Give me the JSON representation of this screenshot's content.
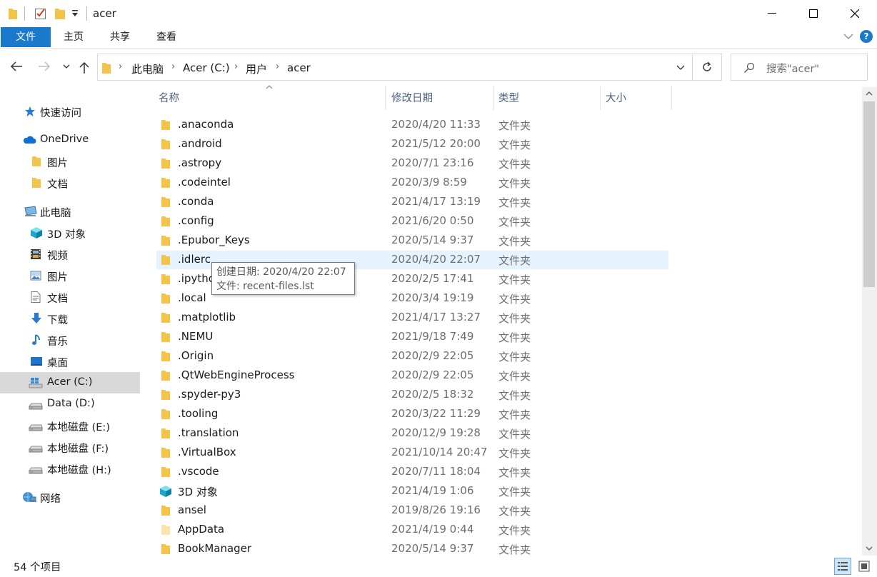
{
  "window": {
    "title": "acer",
    "colors": {
      "accent": "#1979ca",
      "folder": "#f3c34a",
      "hover": "#e5f3ff",
      "selected": "#d9d9d9"
    }
  },
  "ribbon": {
    "tabs": [
      "文件",
      "主页",
      "共享",
      "查看"
    ]
  },
  "address": {
    "crumbs": [
      "此电脑",
      "Acer (C:)",
      "用户",
      "acer"
    ],
    "search_placeholder": "搜索\"acer\""
  },
  "nav": {
    "items": [
      {
        "label": "快速访问",
        "icon": "star-icon"
      },
      {
        "label": "OneDrive",
        "icon": "cloud-icon"
      },
      {
        "label": "图片",
        "icon": "folder-icon"
      },
      {
        "label": "文档",
        "icon": "folder-icon"
      },
      {
        "label": "此电脑",
        "icon": "computer-icon"
      },
      {
        "label": "3D 对象",
        "icon": "cube-icon"
      },
      {
        "label": "视频",
        "icon": "film-icon"
      },
      {
        "label": "图片",
        "icon": "picture-icon"
      },
      {
        "label": "文档",
        "icon": "document-icon"
      },
      {
        "label": "下载",
        "icon": "download-arrow-icon"
      },
      {
        "label": "音乐",
        "icon": "music-note-icon"
      },
      {
        "label": "桌面",
        "icon": "desktop-icon"
      },
      {
        "label": "Acer (C:)",
        "icon": "windows-drive-icon"
      },
      {
        "label": "Data (D:)",
        "icon": "drive-icon"
      },
      {
        "label": "本地磁盘 (E:)",
        "icon": "drive-icon"
      },
      {
        "label": "本地磁盘 (F:)",
        "icon": "drive-icon"
      },
      {
        "label": "本地磁盘 (H:)",
        "icon": "drive-icon"
      },
      {
        "label": "网络",
        "icon": "network-icon"
      }
    ]
  },
  "columns": {
    "name": "名称",
    "modified": "修改日期",
    "type": "类型",
    "size": "大小"
  },
  "files": [
    {
      "name": ".anaconda",
      "date": "2020/4/20 11:33",
      "type": "文件夹"
    },
    {
      "name": ".android",
      "date": "2021/5/12 20:00",
      "type": "文件夹"
    },
    {
      "name": ".astropy",
      "date": "2020/7/1 23:16",
      "type": "文件夹"
    },
    {
      "name": ".codeintel",
      "date": "2020/3/9 8:59",
      "type": "文件夹"
    },
    {
      "name": ".conda",
      "date": "2021/4/17 13:19",
      "type": "文件夹"
    },
    {
      "name": ".config",
      "date": "2021/6/20 0:50",
      "type": "文件夹"
    },
    {
      "name": ".Epubor_Keys",
      "date": "2020/5/14 9:37",
      "type": "文件夹"
    },
    {
      "name": ".idlerc",
      "date": "2020/4/20 22:07",
      "type": "文件夹"
    },
    {
      "name": ".ipython",
      "date": "2020/2/5 17:41",
      "type": "文件夹"
    },
    {
      "name": ".local",
      "date": "2020/3/4 19:19",
      "type": "文件夹"
    },
    {
      "name": ".matplotlib",
      "date": "2021/4/17 13:27",
      "type": "文件夹"
    },
    {
      "name": ".NEMU",
      "date": "2021/9/18 7:49",
      "type": "文件夹"
    },
    {
      "name": ".Origin",
      "date": "2020/2/9 22:05",
      "type": "文件夹"
    },
    {
      "name": ".QtWebEngineProcess",
      "date": "2020/2/9 22:05",
      "type": "文件夹"
    },
    {
      "name": ".spyder-py3",
      "date": "2020/2/5 18:32",
      "type": "文件夹"
    },
    {
      "name": ".tooling",
      "date": "2020/3/22 11:29",
      "type": "文件夹"
    },
    {
      "name": ".translation",
      "date": "2020/12/9 19:28",
      "type": "文件夹"
    },
    {
      "name": ".VirtualBox",
      "date": "2021/10/14 20:47",
      "type": "文件夹"
    },
    {
      "name": ".vscode",
      "date": "2020/7/11 18:04",
      "type": "文件夹"
    },
    {
      "name": "3D 对象",
      "date": "2021/4/19 1:06",
      "type": "文件夹",
      "icon": "cube-icon"
    },
    {
      "name": "ansel",
      "date": "2019/8/26 19:16",
      "type": "文件夹"
    },
    {
      "name": "AppData",
      "date": "2021/4/19 0:44",
      "type": "文件夹",
      "icon": "hidden-folder-icon"
    },
    {
      "name": "BookManager",
      "date": "2020/5/14 9:37",
      "type": "文件夹"
    }
  ],
  "tooltip": {
    "line1": "创建日期: 2020/4/20 22:07",
    "line2": "文件: recent-files.lst"
  },
  "status": {
    "count": "54 个项目"
  }
}
